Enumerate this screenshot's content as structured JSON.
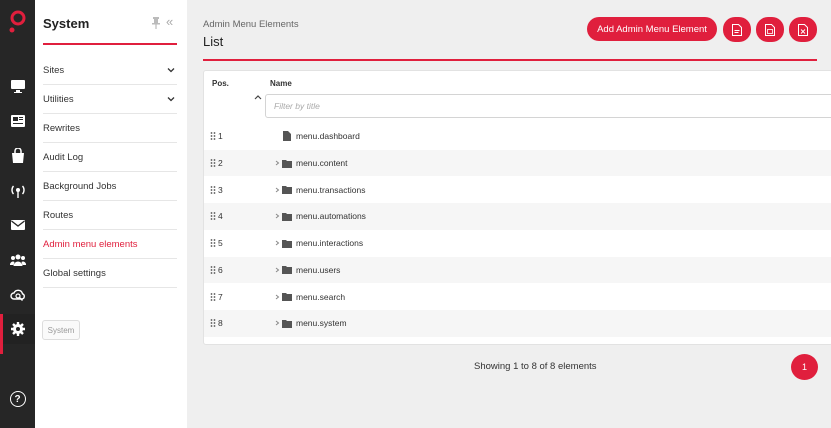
{
  "rail": {
    "items": [
      {
        "icon": "monitor-icon"
      },
      {
        "icon": "newspaper-icon"
      },
      {
        "icon": "shopping-bag-icon"
      },
      {
        "icon": "broadcast-icon"
      },
      {
        "icon": "mail-icon"
      },
      {
        "icon": "users-icon"
      },
      {
        "icon": "cloud-search-icon"
      },
      {
        "icon": "gear-icon"
      }
    ],
    "help_label": "?"
  },
  "sidebar": {
    "title": "System",
    "items": [
      {
        "label": "Sites",
        "has_chevron": true
      },
      {
        "label": "Utilities",
        "has_chevron": true
      },
      {
        "label": "Rewrites"
      },
      {
        "label": "Audit Log"
      },
      {
        "label": "Background Jobs"
      },
      {
        "label": "Routes"
      },
      {
        "label": "Admin menu elements",
        "active": true
      },
      {
        "label": "Global settings"
      }
    ],
    "tooltip": "System"
  },
  "header": {
    "breadcrumb": "Admin Menu Elements",
    "title": "List",
    "add_label": "Add Admin Menu Element",
    "accent": "#e01f3d"
  },
  "table": {
    "columns": {
      "pos": "Pos.",
      "name": "Name"
    },
    "filter_placeholder": "Filter by title",
    "rows": [
      {
        "pos": "1",
        "name": "menu.dashboard",
        "type": "file"
      },
      {
        "pos": "2",
        "name": "menu.content",
        "type": "folder"
      },
      {
        "pos": "3",
        "name": "menu.transactions",
        "type": "folder"
      },
      {
        "pos": "4",
        "name": "menu.automations",
        "type": "folder"
      },
      {
        "pos": "5",
        "name": "menu.interactions",
        "type": "folder"
      },
      {
        "pos": "6",
        "name": "menu.users",
        "type": "folder"
      },
      {
        "pos": "7",
        "name": "menu.search",
        "type": "folder"
      },
      {
        "pos": "8",
        "name": "menu.system",
        "type": "folder"
      }
    ]
  },
  "footer": {
    "showing": "Showing 1 to 8 of 8 elements",
    "current_page": "1"
  }
}
